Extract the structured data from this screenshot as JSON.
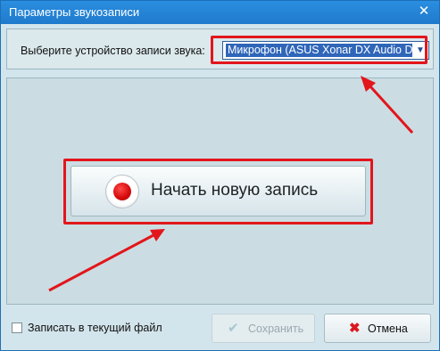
{
  "window": {
    "title": "Параметры звукозаписи",
    "close_symbol": "✕"
  },
  "device": {
    "label": "Выберите устройство записи звука:",
    "selected": "Микрофон (ASUS Xonar DX Audio D",
    "arrow_symbol": "▼"
  },
  "record": {
    "button_label": "Начать новую запись"
  },
  "footer": {
    "checkbox_label": "Записать в текущий файл",
    "checkbox_checked": false,
    "save_label": "Сохранить",
    "save_icon": "✔",
    "cancel_label": "Отмена",
    "cancel_icon": "✖"
  },
  "colors": {
    "annotation": "#e2161c",
    "title_bar": "#1f7acc",
    "selection": "#2f66b9"
  }
}
